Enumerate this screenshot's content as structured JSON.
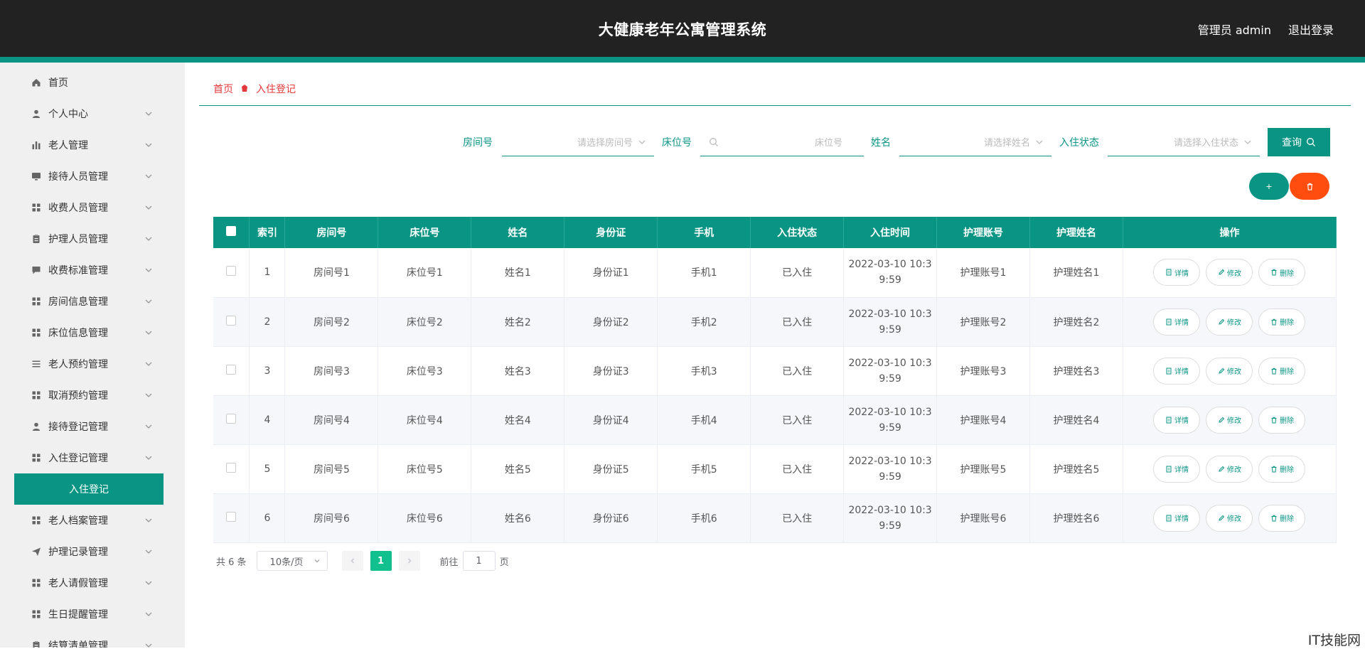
{
  "header": {
    "title": "大健康老年公寓管理系统",
    "user_label": "管理员 admin",
    "logout_label": "退出登录"
  },
  "sidebar": {
    "items": [
      {
        "label": "首页",
        "icon": "home-icon",
        "has_children": false
      },
      {
        "label": "个人中心",
        "icon": "user-icon",
        "has_children": true
      },
      {
        "label": "老人管理",
        "icon": "bar-chart-icon",
        "has_children": true
      },
      {
        "label": "接待人员管理",
        "icon": "monitor-icon",
        "has_children": true
      },
      {
        "label": "收费人员管理",
        "icon": "grid-icon",
        "has_children": true
      },
      {
        "label": "护理人员管理",
        "icon": "clipboard-icon",
        "has_children": true
      },
      {
        "label": "收费标准管理",
        "icon": "chat-icon",
        "has_children": true
      },
      {
        "label": "房间信息管理",
        "icon": "grid-icon",
        "has_children": true
      },
      {
        "label": "床位信息管理",
        "icon": "grid-icon",
        "has_children": true
      },
      {
        "label": "老人预约管理",
        "icon": "list-icon",
        "has_children": true
      },
      {
        "label": "取消预约管理",
        "icon": "grid-icon",
        "has_children": true
      },
      {
        "label": "接待登记管理",
        "icon": "user-icon",
        "has_children": true
      },
      {
        "label": "入住登记管理",
        "icon": "grid-icon",
        "has_children": true
      },
      {
        "label": "老人档案管理",
        "icon": "grid-icon",
        "has_children": true
      },
      {
        "label": "护理记录管理",
        "icon": "send-icon",
        "has_children": true
      },
      {
        "label": "老人请假管理",
        "icon": "grid-icon",
        "has_children": true
      },
      {
        "label": "生日提醒管理",
        "icon": "grid-icon",
        "has_children": true
      },
      {
        "label": "结算清单管理",
        "icon": "clipboard-icon",
        "has_children": true
      }
    ],
    "active_sub": "入住登记"
  },
  "breadcrumb": {
    "home": "首页",
    "current": "入住登记"
  },
  "filters": {
    "room_label": "房间号",
    "room_placeholder": "请选择房间号",
    "bed_label": "床位号",
    "bed_placeholder": "床位号",
    "name_label": "姓名",
    "name_placeholder": "请选择姓名",
    "status_label": "入住状态",
    "status_placeholder": "请选择入住状态",
    "query_label": "查询"
  },
  "actions": {
    "add_label": "+",
    "delete_label": "🗑"
  },
  "table": {
    "headers": [
      "索引",
      "房间号",
      "床位号",
      "姓名",
      "身份证",
      "手机",
      "入住状态",
      "入住时间",
      "护理账号",
      "护理姓名",
      "操作"
    ],
    "op_labels": {
      "detail": "详情",
      "edit": "修改",
      "delete": "删除"
    },
    "rows": [
      {
        "index": "1",
        "room": "房间号1",
        "bed": "床位号1",
        "name": "姓名1",
        "idcard": "身份证1",
        "phone": "手机1",
        "status": "已入住",
        "time_a": "2022-03-10 10:3",
        "time_b": "9:59",
        "nurse_acct": "护理账号1",
        "nurse_name": "护理姓名1"
      },
      {
        "index": "2",
        "room": "房间号2",
        "bed": "床位号2",
        "name": "姓名2",
        "idcard": "身份证2",
        "phone": "手机2",
        "status": "已入住",
        "time_a": "2022-03-10 10:3",
        "time_b": "9:59",
        "nurse_acct": "护理账号2",
        "nurse_name": "护理姓名2"
      },
      {
        "index": "3",
        "room": "房间号3",
        "bed": "床位号3",
        "name": "姓名3",
        "idcard": "身份证3",
        "phone": "手机3",
        "status": "已入住",
        "time_a": "2022-03-10 10:3",
        "time_b": "9:59",
        "nurse_acct": "护理账号3",
        "nurse_name": "护理姓名3"
      },
      {
        "index": "4",
        "room": "房间号4",
        "bed": "床位号4",
        "name": "姓名4",
        "idcard": "身份证4",
        "phone": "手机4",
        "status": "已入住",
        "time_a": "2022-03-10 10:3",
        "time_b": "9:59",
        "nurse_acct": "护理账号4",
        "nurse_name": "护理姓名4"
      },
      {
        "index": "5",
        "room": "房间号5",
        "bed": "床位号5",
        "name": "姓名5",
        "idcard": "身份证5",
        "phone": "手机5",
        "status": "已入住",
        "time_a": "2022-03-10 10:3",
        "time_b": "9:59",
        "nurse_acct": "护理账号5",
        "nurse_name": "护理姓名5"
      },
      {
        "index": "6",
        "room": "房间号6",
        "bed": "床位号6",
        "name": "姓名6",
        "idcard": "身份证6",
        "phone": "手机6",
        "status": "已入住",
        "time_a": "2022-03-10 10:3",
        "time_b": "9:59",
        "nurse_acct": "护理账号6",
        "nurse_name": "护理姓名6"
      }
    ]
  },
  "pagination": {
    "total": "共 6 条",
    "page_size": "10条/页",
    "current_page": "1",
    "goto_label": "前往",
    "goto_value": "1",
    "page_unit": "页"
  },
  "watermark": "IT技能网",
  "colors": {
    "primary": "#0a9484",
    "danger": "#ff4d0f",
    "topbar": "#222222",
    "page_active": "#12c08e"
  }
}
